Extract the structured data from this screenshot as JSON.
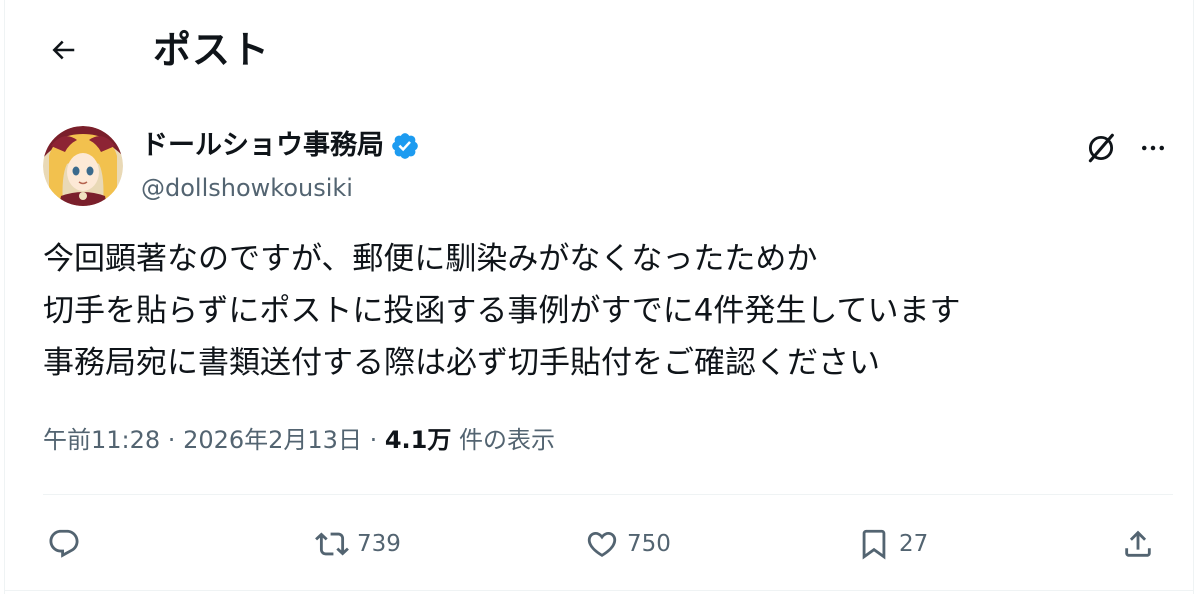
{
  "header": {
    "title": "ポスト",
    "back_icon": "arrow-left-icon"
  },
  "author": {
    "display_name": "ドールショウ事務局",
    "handle": "@dollshowkousiki",
    "verified": true,
    "verified_color": "#1d9bf0"
  },
  "post": {
    "lines": [
      "今回顕著なのですが、郵便に馴染みがなくなったためか",
      "切手を貼らずにポストに投函する事例がすでに4件発生しています",
      "事務局宛に書類送付する際は必ず切手貼付をご確認ください"
    ]
  },
  "meta": {
    "time": "午前11:28",
    "separator1": " · ",
    "date": "2026年2月13日",
    "separator2": " · ",
    "views_count": "4.1万",
    "views_label": " 件の表示"
  },
  "actions": {
    "reply": {
      "icon": "reply-icon",
      "count": ""
    },
    "repost": {
      "icon": "repost-icon",
      "count": "739"
    },
    "like": {
      "icon": "heart-icon",
      "count": "750"
    },
    "bookmark": {
      "icon": "bookmark-icon",
      "count": "27"
    },
    "share": {
      "icon": "share-icon",
      "count": ""
    }
  },
  "colors": {
    "text_primary": "#0f1419",
    "text_secondary": "#536471",
    "border": "#eff3f4"
  }
}
